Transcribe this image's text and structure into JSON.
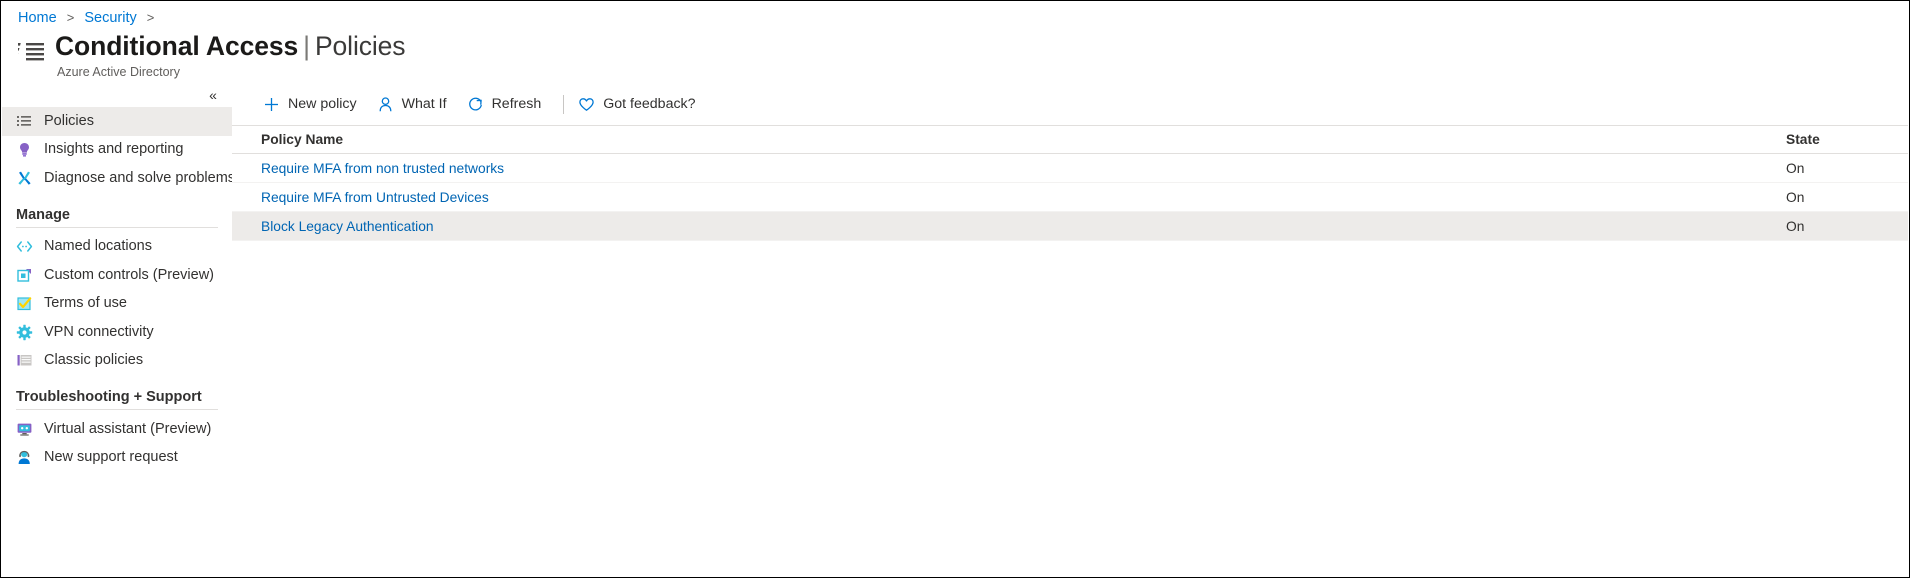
{
  "breadcrumb": {
    "items": [
      {
        "label": "Home"
      },
      {
        "label": "Security"
      }
    ],
    "separator": ">"
  },
  "header": {
    "title_main": "Conditional Access",
    "title_separator": "|",
    "title_sub": "Policies",
    "caption": "Azure Active Directory",
    "icon": "policy-list-icon"
  },
  "sidebar": {
    "collapse_label": "«",
    "items": [
      {
        "label": "Policies",
        "icon": "list-icon",
        "selected": true
      },
      {
        "label": "Insights and reporting",
        "icon": "lightbulb-icon",
        "selected": false
      },
      {
        "label": "Diagnose and solve problems",
        "icon": "wrench-icon",
        "selected": false
      }
    ],
    "groups": [
      {
        "label": "Manage",
        "items": [
          {
            "label": "Named locations",
            "icon": "code-brackets-icon"
          },
          {
            "label": "Custom controls (Preview)",
            "icon": "custom-control-icon"
          },
          {
            "label": "Terms of use",
            "icon": "checkbox-icon"
          },
          {
            "label": "VPN connectivity",
            "icon": "gear-icon"
          },
          {
            "label": "Classic policies",
            "icon": "classic-list-icon"
          }
        ]
      },
      {
        "label": "Troubleshooting + Support",
        "items": [
          {
            "label": "Virtual assistant (Preview)",
            "icon": "virtual-assistant-icon"
          },
          {
            "label": "New support request",
            "icon": "support-person-icon"
          }
        ]
      }
    ]
  },
  "toolbar": {
    "commands": [
      {
        "label": "New policy",
        "icon": "plus-icon"
      },
      {
        "label": "What If",
        "icon": "person-icon"
      },
      {
        "label": "Refresh",
        "icon": "refresh-icon"
      }
    ],
    "feedback": {
      "label": "Got feedback?",
      "icon": "heart-icon"
    }
  },
  "table": {
    "columns": [
      {
        "key": "name",
        "label": "Policy Name"
      },
      {
        "key": "state",
        "label": "State"
      }
    ],
    "rows": [
      {
        "name": "Require MFA from non trusted networks",
        "state": "On",
        "highlight": false
      },
      {
        "name": "Require MFA from Untrusted Devices",
        "state": "On",
        "highlight": false
      },
      {
        "name": "Block Legacy Authentication",
        "state": "On",
        "highlight": true
      }
    ]
  },
  "colors": {
    "accent": "#0078d4",
    "link": "#0065b3",
    "selected_bg": "#edebe9",
    "text": "#323130"
  }
}
